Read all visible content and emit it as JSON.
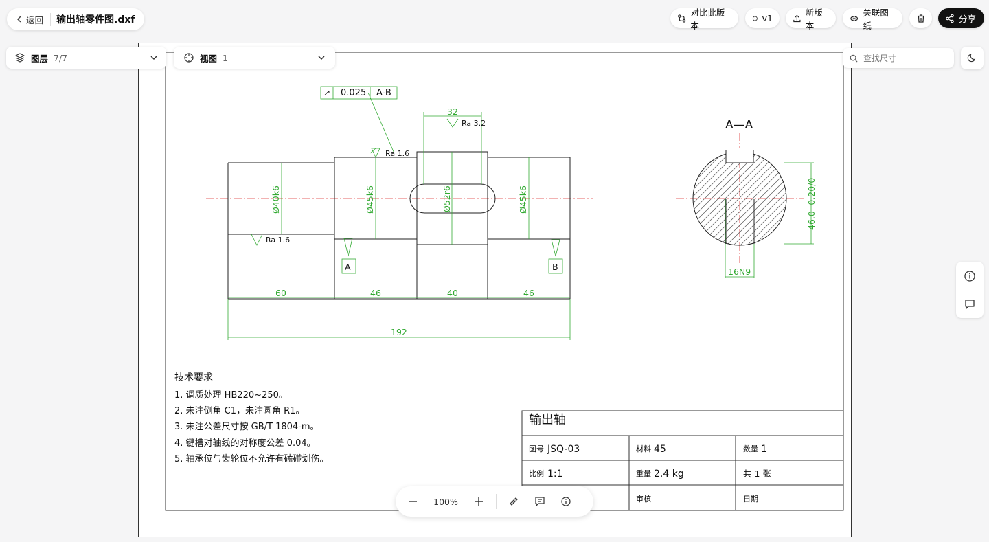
{
  "topbar": {
    "back_label": "返回",
    "file_name": "输出轴零件图.dxf",
    "compare_label": "对比此版本",
    "version_label": "v1",
    "new_version_label": "新版本",
    "link_label": "关联图纸",
    "share_label": "分享"
  },
  "layers": {
    "label": "图层",
    "count": "7/7"
  },
  "views": {
    "label": "视图",
    "count": "1"
  },
  "search": {
    "placeholder": "查找尺寸"
  },
  "zoom": {
    "level": "100%"
  },
  "drawing": {
    "section_title": "A—A",
    "tolerance": {
      "symbol": "↗",
      "value": "0.025",
      "datum": "A-B"
    },
    "roughness": [
      "Ra 3.2",
      "Ra 1.6",
      "Ra 1.6"
    ],
    "dims": {
      "d1": "Ø40k6",
      "d2": "Ø45k6",
      "d3": "Ø52r6",
      "d4": "Ø45k6",
      "keyway_len": "32",
      "seg1": "60",
      "seg2": "46",
      "seg3": "40",
      "seg4": "46",
      "total": "192",
      "section_h": "46.0 -0.20/0",
      "keyway_w": "16N9"
    },
    "datum_a": "A",
    "datum_b": "B",
    "tech": {
      "heading": "技术要求",
      "items": [
        "1. 调质处理 HB220~250。",
        "2. 未注倒角 C1，未注圆角 R1。",
        "3. 未注公差尺寸按 GB/T 1804-m。",
        "4. 键槽对轴线的对称度公差 0.04。",
        "5. 轴承位与齿轮位不允许有磕碰划伤。"
      ]
    },
    "title_block": {
      "part_name": "输出轴",
      "drawing_no_label": "图号",
      "drawing_no": "JSQ-03",
      "material_label": "材料",
      "material": "45",
      "qty_label": "数量",
      "qty": "1",
      "scale_label": "比例",
      "scale": "1:1",
      "weight_label": "重量",
      "weight": "2.4 kg",
      "sheets": "共 1 张",
      "review_label": "审核",
      "date_label": "日期"
    }
  }
}
